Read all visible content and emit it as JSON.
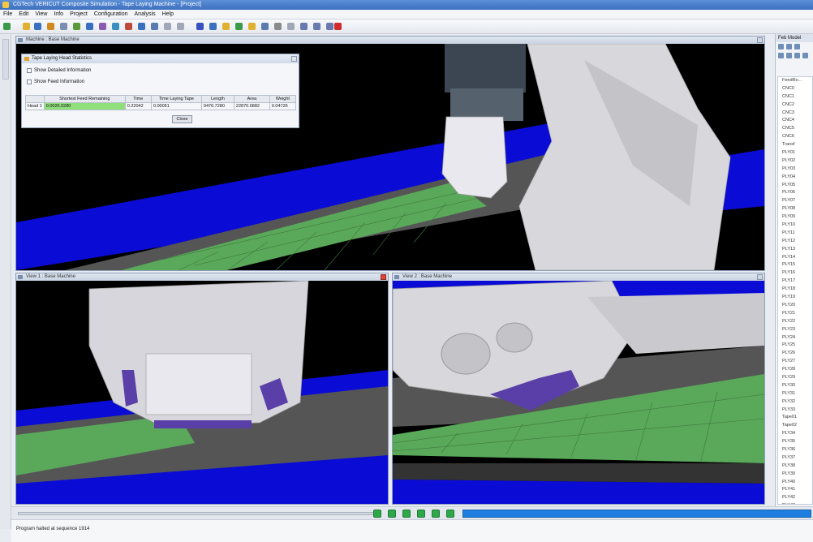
{
  "app": {
    "title": "CGTech VERICUT Composite Simulation - Tape Laying Machine - [Project]"
  },
  "menu": [
    "File",
    "Edit",
    "View",
    "Info",
    "Project",
    "Configuration",
    "Analysis",
    "Help"
  ],
  "views": {
    "main": {
      "title": "Machine : Base Machine"
    },
    "view1": {
      "title": "View 1 : Base Machine"
    },
    "view2": {
      "title": "View 2 : Base Machine"
    }
  },
  "dialog": {
    "title": "Tape Laying Head Statistics",
    "check1": "Show Detailed Information",
    "check2": "Show Feed Information",
    "columns": [
      "",
      "Shortest Feed Remaining",
      "Time",
      "Time Laying Tape",
      "Length",
      "Area",
      "Weight"
    ],
    "row": [
      "Head 1",
      "0.0026.0280",
      "0.22042",
      "0.00051",
      "0476.7280",
      "22870.0882",
      "0.04726"
    ],
    "button": "Close"
  },
  "right_panel": {
    "title": "Feb Model",
    "items": [
      "FeedRo...",
      "CNC0",
      "CNC1",
      "CNC2",
      "CNC3",
      "CNC4",
      "CNC5",
      "CNC6",
      "Transf",
      "PLY01",
      "PLY02",
      "PLY03",
      "PLY04",
      "PLY05",
      "PLY06",
      "PLY07",
      "PLY08",
      "PLY09",
      "PLY10",
      "PLY11",
      "PLY12",
      "PLY13",
      "PLY14",
      "PLY15",
      "PLY16",
      "PLY17",
      "PLY18",
      "PLY19",
      "PLY20",
      "PLY21",
      "PLY22",
      "PLY23",
      "PLY24",
      "PLY25",
      "PLY26",
      "PLY27",
      "PLY28",
      "PLY29",
      "PLY30",
      "PLY31",
      "PLY32",
      "PLY33",
      "Tape01",
      "Tape02",
      "PLY34",
      "PLY35",
      "PLY36",
      "PLY37",
      "PLY38",
      "PLY39",
      "PLY40",
      "PLY41",
      "PLY42",
      "PLY43",
      "PLY44",
      "PLY45"
    ]
  },
  "progress": {
    "fraction": 1.0
  },
  "status": {
    "text": "Program halted at sequence 1914"
  },
  "colors": {
    "conveyor_blue": "#0b0bd6",
    "tape_green": "#5aa85a",
    "bed_gray": "#555555",
    "machine_gray": "#c8c8cc",
    "head_purple": "#5a3fa8"
  }
}
